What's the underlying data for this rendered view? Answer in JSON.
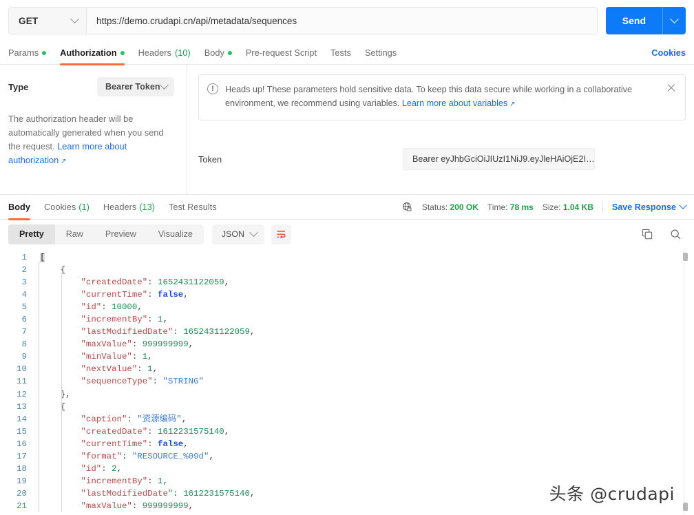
{
  "request": {
    "method": "GET",
    "url": "https://demo.crudapi.cn/api/metadata/sequences",
    "send_label": "Send",
    "tabs": [
      {
        "label": "Params",
        "dot": true,
        "active": false
      },
      {
        "label": "Authorization",
        "dot": true,
        "active": true
      },
      {
        "label": "Headers",
        "count": "(10)",
        "dot": false,
        "active": false
      },
      {
        "label": "Body",
        "dot": true,
        "active": false
      },
      {
        "label": "Pre-request Script",
        "dot": false,
        "active": false
      },
      {
        "label": "Tests",
        "dot": false,
        "active": false
      },
      {
        "label": "Settings",
        "dot": false,
        "active": false
      }
    ],
    "cookies_link": "Cookies"
  },
  "auth": {
    "type_label": "Type",
    "type_value": "Bearer Token",
    "description_prefix": "The authorization header will be automatically generated when you send the request. ",
    "description_link": "Learn more about authorization",
    "notice_text_prefix": "Heads up! These parameters hold sensitive data. To keep this data secure while working in a collaborative environment, we recommend using variables. ",
    "notice_link": "Learn more about variables",
    "token_label": "Token",
    "token_value": "Bearer eyJhbGciOiJIUzI1NiJ9.eyJleHAiOjE2I…"
  },
  "response": {
    "tabs": [
      {
        "label": "Body",
        "count": "",
        "active": true
      },
      {
        "label": "Cookies",
        "count": "(1)",
        "active": false
      },
      {
        "label": "Headers",
        "count": "(13)",
        "active": false
      },
      {
        "label": "Test Results",
        "count": "",
        "active": false
      }
    ],
    "status_label": "Status:",
    "status_value": "200 OK",
    "time_label": "Time:",
    "time_value": "78 ms",
    "size_label": "Size:",
    "size_value": "1.04 KB",
    "save_response": "Save Response",
    "view_modes": [
      {
        "label": "Pretty",
        "active": true
      },
      {
        "label": "Raw",
        "active": false
      },
      {
        "label": "Preview",
        "active": false
      },
      {
        "label": "Visualize",
        "active": false
      }
    ],
    "format": "JSON"
  },
  "code": {
    "lines": [
      {
        "n": 1,
        "tokens": [
          {
            "t": "[",
            "c": "brk"
          }
        ]
      },
      {
        "n": 2,
        "tokens": [
          {
            "t": "    {",
            "c": "p"
          }
        ]
      },
      {
        "n": 3,
        "tokens": [
          {
            "t": "        ",
            "c": "p"
          },
          {
            "t": "\"createdDate\"",
            "c": "k"
          },
          {
            "t": ": ",
            "c": "p"
          },
          {
            "t": "1652431122059",
            "c": "n"
          },
          {
            "t": ",",
            "c": "p"
          }
        ]
      },
      {
        "n": 4,
        "tokens": [
          {
            "t": "        ",
            "c": "p"
          },
          {
            "t": "\"currentTime\"",
            "c": "k"
          },
          {
            "t": ": ",
            "c": "p"
          },
          {
            "t": "false",
            "c": "b"
          },
          {
            "t": ",",
            "c": "p"
          }
        ]
      },
      {
        "n": 5,
        "tokens": [
          {
            "t": "        ",
            "c": "p"
          },
          {
            "t": "\"id\"",
            "c": "k"
          },
          {
            "t": ": ",
            "c": "p"
          },
          {
            "t": "10000",
            "c": "n"
          },
          {
            "t": ",",
            "c": "p"
          }
        ]
      },
      {
        "n": 6,
        "tokens": [
          {
            "t": "        ",
            "c": "p"
          },
          {
            "t": "\"incrementBy\"",
            "c": "k"
          },
          {
            "t": ": ",
            "c": "p"
          },
          {
            "t": "1",
            "c": "n"
          },
          {
            "t": ",",
            "c": "p"
          }
        ]
      },
      {
        "n": 7,
        "tokens": [
          {
            "t": "        ",
            "c": "p"
          },
          {
            "t": "\"lastModifiedDate\"",
            "c": "k"
          },
          {
            "t": ": ",
            "c": "p"
          },
          {
            "t": "1652431122059",
            "c": "n"
          },
          {
            "t": ",",
            "c": "p"
          }
        ]
      },
      {
        "n": 8,
        "tokens": [
          {
            "t": "        ",
            "c": "p"
          },
          {
            "t": "\"maxValue\"",
            "c": "k"
          },
          {
            "t": ": ",
            "c": "p"
          },
          {
            "t": "999999999",
            "c": "n"
          },
          {
            "t": ",",
            "c": "p"
          }
        ]
      },
      {
        "n": 9,
        "tokens": [
          {
            "t": "        ",
            "c": "p"
          },
          {
            "t": "\"minValue\"",
            "c": "k"
          },
          {
            "t": ": ",
            "c": "p"
          },
          {
            "t": "1",
            "c": "n"
          },
          {
            "t": ",",
            "c": "p"
          }
        ]
      },
      {
        "n": 10,
        "tokens": [
          {
            "t": "        ",
            "c": "p"
          },
          {
            "t": "\"nextValue\"",
            "c": "k"
          },
          {
            "t": ": ",
            "c": "p"
          },
          {
            "t": "1",
            "c": "n"
          },
          {
            "t": ",",
            "c": "p"
          }
        ]
      },
      {
        "n": 11,
        "tokens": [
          {
            "t": "        ",
            "c": "p"
          },
          {
            "t": "\"sequenceType\"",
            "c": "k"
          },
          {
            "t": ": ",
            "c": "p"
          },
          {
            "t": "\"STRING\"",
            "c": "s"
          }
        ]
      },
      {
        "n": 12,
        "tokens": [
          {
            "t": "    },",
            "c": "p"
          }
        ]
      },
      {
        "n": 13,
        "tokens": [
          {
            "t": "    {",
            "c": "p"
          }
        ]
      },
      {
        "n": 14,
        "tokens": [
          {
            "t": "        ",
            "c": "p"
          },
          {
            "t": "\"caption\"",
            "c": "k"
          },
          {
            "t": ": ",
            "c": "p"
          },
          {
            "t": "\"资源编码\"",
            "c": "s"
          },
          {
            "t": ",",
            "c": "p"
          }
        ]
      },
      {
        "n": 15,
        "tokens": [
          {
            "t": "        ",
            "c": "p"
          },
          {
            "t": "\"createdDate\"",
            "c": "k"
          },
          {
            "t": ": ",
            "c": "p"
          },
          {
            "t": "1612231575140",
            "c": "n"
          },
          {
            "t": ",",
            "c": "p"
          }
        ]
      },
      {
        "n": 16,
        "tokens": [
          {
            "t": "        ",
            "c": "p"
          },
          {
            "t": "\"currentTime\"",
            "c": "k"
          },
          {
            "t": ": ",
            "c": "p"
          },
          {
            "t": "false",
            "c": "b"
          },
          {
            "t": ",",
            "c": "p"
          }
        ]
      },
      {
        "n": 17,
        "tokens": [
          {
            "t": "        ",
            "c": "p"
          },
          {
            "t": "\"format\"",
            "c": "k"
          },
          {
            "t": ": ",
            "c": "p"
          },
          {
            "t": "\"RESOURCE_%09d\"",
            "c": "s"
          },
          {
            "t": ",",
            "c": "p"
          }
        ]
      },
      {
        "n": 18,
        "tokens": [
          {
            "t": "        ",
            "c": "p"
          },
          {
            "t": "\"id\"",
            "c": "k"
          },
          {
            "t": ": ",
            "c": "p"
          },
          {
            "t": "2",
            "c": "n"
          },
          {
            "t": ",",
            "c": "p"
          }
        ]
      },
      {
        "n": 19,
        "tokens": [
          {
            "t": "        ",
            "c": "p"
          },
          {
            "t": "\"incrementBy\"",
            "c": "k"
          },
          {
            "t": ": ",
            "c": "p"
          },
          {
            "t": "1",
            "c": "n"
          },
          {
            "t": ",",
            "c": "p"
          }
        ]
      },
      {
        "n": 20,
        "tokens": [
          {
            "t": "        ",
            "c": "p"
          },
          {
            "t": "\"lastModifiedDate\"",
            "c": "k"
          },
          {
            "t": ": ",
            "c": "p"
          },
          {
            "t": "1612231575140",
            "c": "n"
          },
          {
            "t": ",",
            "c": "p"
          }
        ]
      },
      {
        "n": 21,
        "tokens": [
          {
            "t": "        ",
            "c": "p"
          },
          {
            "t": "\"maxValue\"",
            "c": "k"
          },
          {
            "t": ": ",
            "c": "p"
          },
          {
            "t": "999999999",
            "c": "n"
          },
          {
            "t": ",",
            "c": "p"
          }
        ]
      }
    ]
  },
  "watermark": "头条 @crudapi",
  "colors": {
    "accent_orange": "#ff6c37",
    "link_blue": "#1a6ce7",
    "send_blue": "#0d7bf7",
    "status_green": "#16a34a",
    "dot_green": "#22c55e"
  }
}
